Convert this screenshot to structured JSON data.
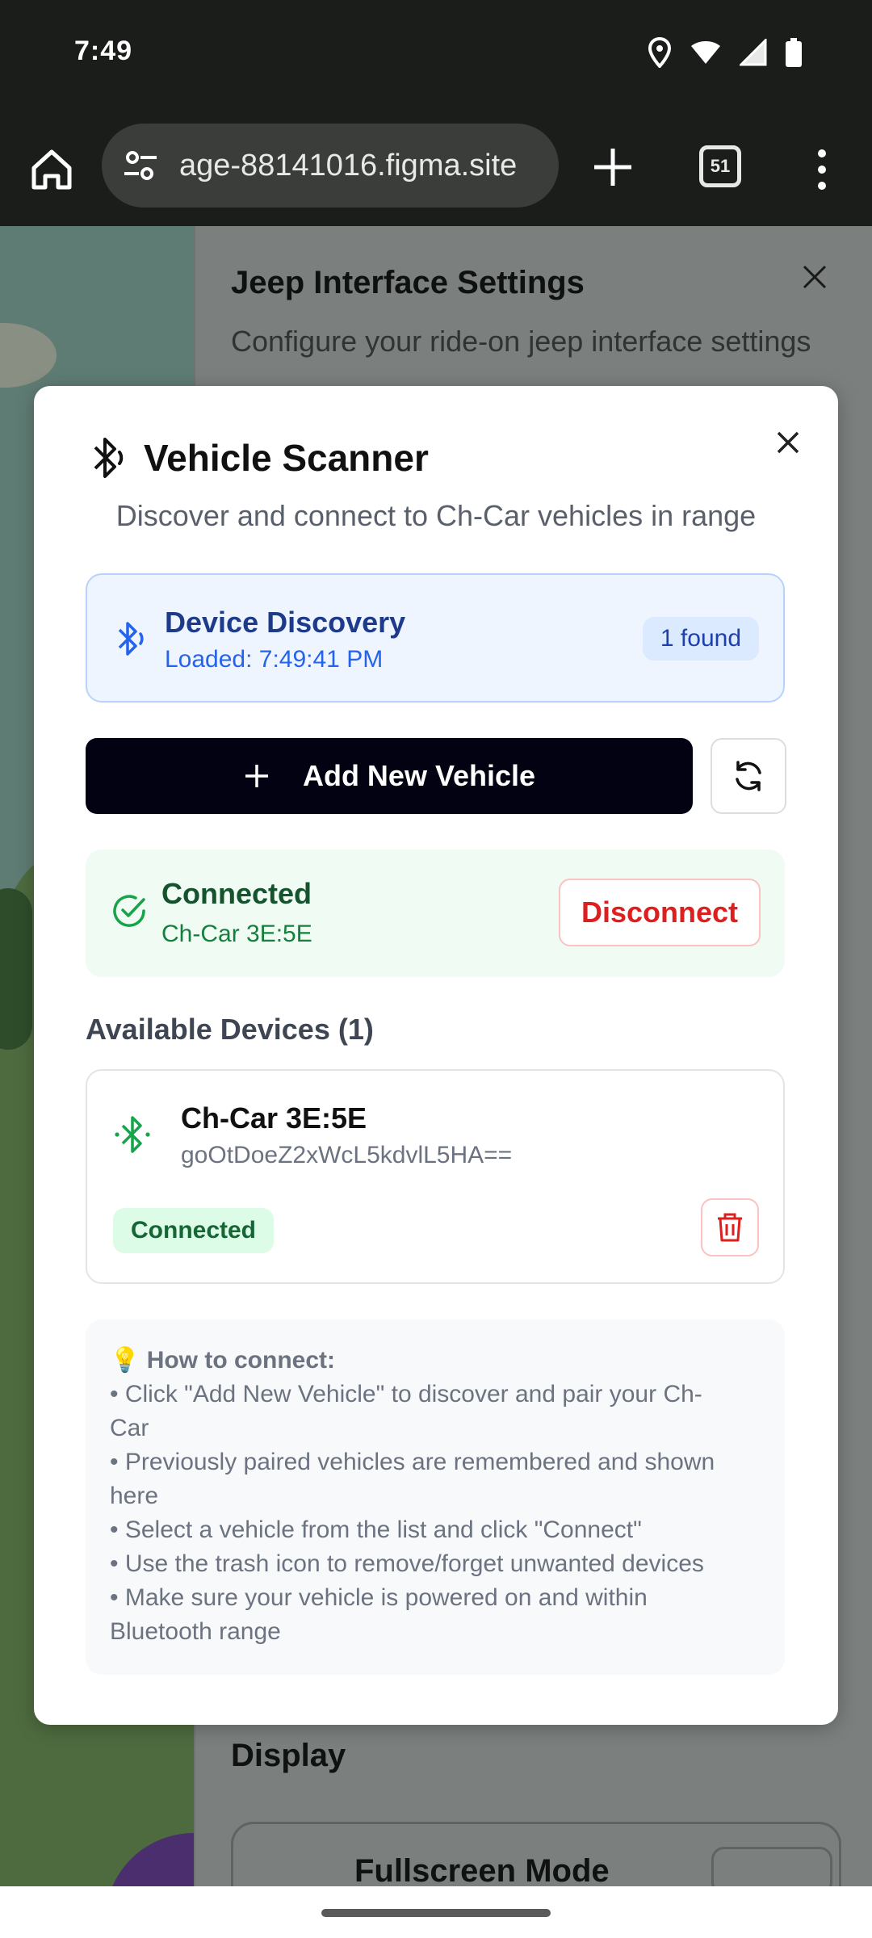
{
  "status_bar": {
    "time": "7:49"
  },
  "browser": {
    "url": "age-88141016.figma.site",
    "tab_count": "51"
  },
  "background_page": {
    "title": "Jeep Interface Settings",
    "subtitle": "Configure your ride-on jeep interface settings",
    "section": "Display",
    "card_title": "Fullscreen Mode"
  },
  "dialog": {
    "title": "Vehicle Scanner",
    "description": "Discover and connect to Ch-Car vehicles in range",
    "discovery": {
      "title": "Device Discovery",
      "loaded": "Loaded: 7:49:41 PM",
      "badge": "1 found"
    },
    "add_button": "Add New Vehicle",
    "connection": {
      "title": "Connected",
      "device": "Ch-Car 3E:5E",
      "disconnect_label": "Disconnect"
    },
    "available_title": "Available Devices (1)",
    "devices": [
      {
        "name": "Ch-Car 3E:5E",
        "id": "goOtDoeZ2xWcL5kdvlL5HA==",
        "status": "Connected"
      }
    ],
    "howto": {
      "title": "💡 How to connect:",
      "lines": [
        "• Click \"Add New Vehicle\" to discover and pair your Ch-",
        "Car",
        "• Previously paired vehicles are remembered and shown",
        "here",
        "• Select a vehicle from the list and click \"Connect\"",
        "• Use the trash icon to remove/forget unwanted devices",
        "• Make sure your vehicle is powered on and within",
        "Bluetooth range"
      ]
    }
  },
  "colors": {
    "primary": "#030213",
    "discovery_bg": "#eff5ff",
    "connected_bg": "#effbf3",
    "danger": "#dc1f1f",
    "success": "#16a34a"
  }
}
